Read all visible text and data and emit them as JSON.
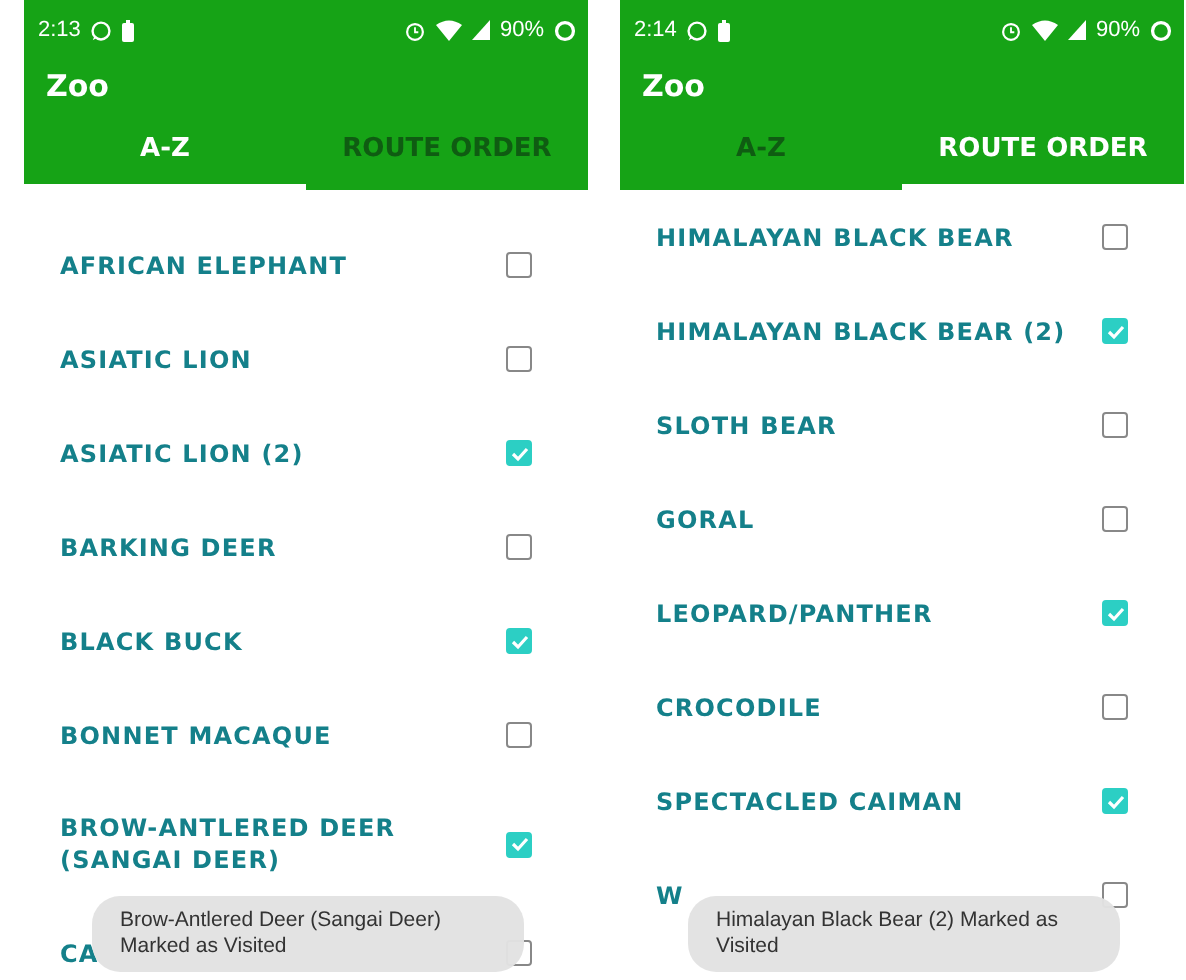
{
  "screens": [
    {
      "status_bar": {
        "time": "2:13",
        "battery": "90%"
      },
      "app_title": "Zoo",
      "tabs": [
        {
          "label": "A-Z",
          "selected": true
        },
        {
          "label": "ROUTE ORDER",
          "selected": false
        }
      ],
      "items": [
        {
          "name": "AFRICAN ELEPHANT",
          "checked": false
        },
        {
          "name": "ASIATIC LION",
          "checked": false
        },
        {
          "name": "ASIATIC LION (2)",
          "checked": true
        },
        {
          "name": "BARKING DEER",
          "checked": false
        },
        {
          "name": "BLACK BUCK",
          "checked": true
        },
        {
          "name": "BONNET MACAQUE",
          "checked": false
        },
        {
          "name": "BROW-ANTLERED DEER (SANGAI DEER)",
          "checked": true
        },
        {
          "name": "CA",
          "checked": false
        }
      ],
      "toast": "Brow-Antlered Deer (Sangai Deer) Marked as Visited"
    },
    {
      "status_bar": {
        "time": "2:14",
        "battery": "90%"
      },
      "app_title": "Zoo",
      "tabs": [
        {
          "label": "A-Z",
          "selected": false
        },
        {
          "label": "ROUTE ORDER",
          "selected": true
        }
      ],
      "items": [
        {
          "name": "HIMALAYAN BLACK BEAR",
          "checked": false
        },
        {
          "name": "HIMALAYAN BLACK BEAR (2)",
          "checked": true
        },
        {
          "name": "SLOTH BEAR",
          "checked": false
        },
        {
          "name": "GORAL",
          "checked": false
        },
        {
          "name": "LEOPARD/PANTHER",
          "checked": true
        },
        {
          "name": "CROCODILE",
          "checked": false
        },
        {
          "name": "SPECTACLED CAIMAN",
          "checked": true
        },
        {
          "name": "W",
          "checked": false
        }
      ],
      "toast": "Himalayan Black Bear (2) Marked as Visited"
    }
  ]
}
